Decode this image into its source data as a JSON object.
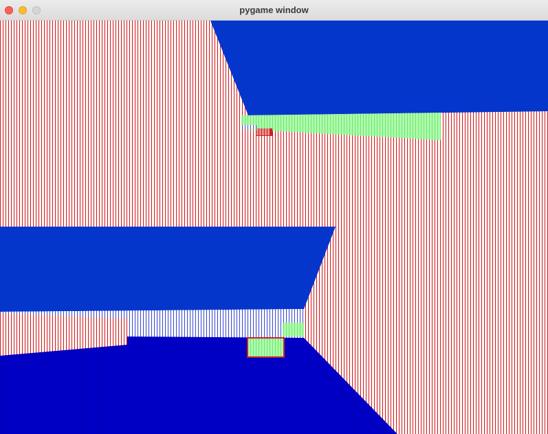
{
  "window": {
    "title": "pygame window"
  },
  "colors": {
    "wall_red_stripe": "#cc1111",
    "wall_bg": "#ffffff",
    "sky_blue": "#0033cc",
    "floor_blue": "#0000cc",
    "ledge_green": "#99ff99",
    "ledge_blue_stripe": "#3344cc",
    "block_red": "#cc2222"
  },
  "icons": {
    "close": "close-icon",
    "minimize": "minimize-icon",
    "zoom": "zoom-icon"
  }
}
